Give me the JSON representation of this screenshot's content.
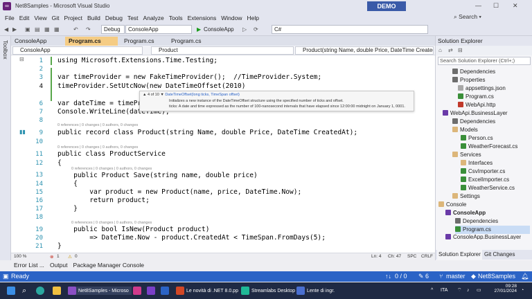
{
  "window": {
    "title": "Net8Samples - Microsoft Visual Studio",
    "badge": "DEMO"
  },
  "menu": [
    "File",
    "Edit",
    "View",
    "Git",
    "Project",
    "Build",
    "Debug",
    "Test",
    "Analyze",
    "Tools",
    "Extensions",
    "Window",
    "Help"
  ],
  "search_label": "Search",
  "toolbar": {
    "config": "Debug",
    "platform": "ConsoleApp",
    "run_label": "ConsoleApp",
    "lang": "C#"
  },
  "left_strip": "Toolbox",
  "tabs": [
    {
      "label": "ConsoleApp",
      "active": false
    },
    {
      "label": "Program.cs",
      "active": true
    },
    {
      "label": "Program.cs",
      "active": false
    },
    {
      "label": "Program.cs",
      "active": false
    }
  ],
  "nav": {
    "project": "ConsoleApp",
    "type": "Product",
    "member": "Product(string Name, double Price, DateTime CreatedAt)"
  },
  "lines": [
    {
      "n": "1",
      "text": "using Microsoft.Extensions.Time.Testing;"
    },
    {
      "n": "2",
      "text": ""
    },
    {
      "n": "3",
      "text": "var timeProvider = new FakeTimeProvider();  //TimeProvider.System;"
    },
    {
      "n": "4",
      "text": "timeProvider.SetUtcNow(new DateTimeOffset(2010)"
    },
    {
      "n": "5",
      "text": ""
    },
    {
      "n": "6",
      "text": "var dateTime = timeProvider.GetUtcNow();"
    },
    {
      "n": "7",
      "text": "Console.WriteLine(dateTime);"
    },
    {
      "n": "8",
      "text": ""
    },
    {
      "n": "9",
      "text": "public record class Product(string Name, double Price, DateTime CreatedAt);"
    },
    {
      "n": "10",
      "text": ""
    },
    {
      "n": "11",
      "text": "public class ProductService"
    },
    {
      "n": "12",
      "text": "{"
    },
    {
      "n": "13",
      "text": "    public Product Save(string name, double price)"
    },
    {
      "n": "14",
      "text": "    {"
    },
    {
      "n": "15",
      "text": "        var product = new Product(name, price, DateTime.Now);"
    },
    {
      "n": "16",
      "text": "        return product;"
    },
    {
      "n": "17",
      "text": "    }"
    },
    {
      "n": "18",
      "text": ""
    },
    {
      "n": "19",
      "text": "    public bool IsNew(Product product)"
    },
    {
      "n": "20",
      "text": "        => DateTime.Now - product.CreatedAt < TimeSpan.FromDays(5);"
    },
    {
      "n": "21",
      "text": "}"
    }
  ],
  "lens": {
    "l9": "0 references | 0 changes | 0 authors, 0 changes",
    "l11": "0 references | 0 changes | 0 authors, 0 changes",
    "l13": "0 references | 0 changes | 0 authors, 0 changes",
    "l19": "0 references | 0 changes | 0 authors, 0 changes"
  },
  "tooltip": {
    "counter": "4 of 10",
    "signature": "DateTimeOffset(long ticks, TimeSpan offset)",
    "desc": "Initializes a new instance of the DateTimeOffset structure using the specified number of ticks and offset.",
    "param": "ticks: A date and time expressed as the number of 100-nanosecond intervals that have elapsed since 12:00:00 midnight on January 1, 0001."
  },
  "editor_status": {
    "zoom": "100 %",
    "errors": "1",
    "warnings": "0",
    "ln": "Ln: 4",
    "ch": "Ch: 47",
    "spc": "SPC",
    "crlf": "CRLF"
  },
  "solution_explorer": {
    "title": "Solution Explorer",
    "search_placeholder": "Search Solution Explorer (Ctrl+;)",
    "items": [
      "Dependencies",
      "Properties",
      "appsettings.json",
      "Program.cs",
      "WebApi.http",
      "WebApi.BusinessLayer",
      "Dependencies",
      "Models",
      "Person.cs",
      "WeatherForecast.cs",
      "Services",
      "Interfaces",
      "CsvImporter.cs",
      "ExcelImporter.cs",
      "WeatherService.cs",
      "Settings",
      "Console",
      "ConsoleApp",
      "Dependencies",
      "Program.cs",
      "ConsoleApp.BusinessLayer"
    ],
    "footer_tabs": [
      "Solution Explorer",
      "Git Changes"
    ]
  },
  "bottom_tabs": [
    "Error List ...",
    "Output",
    "Package Manager Console"
  ],
  "status": {
    "left": "Ready",
    "git": "0 / 0",
    "pencil": "6",
    "branch": "master",
    "repo": "Net8Samples"
  },
  "taskbar": {
    "apps": [
      "Net8Samples - Microso",
      "Le novità di .NET 8.0.pp",
      "Streamlabs Desktop",
      "Lente di ingr."
    ],
    "lang": "ITA",
    "time": "09:28",
    "date": "27/01/2024"
  }
}
